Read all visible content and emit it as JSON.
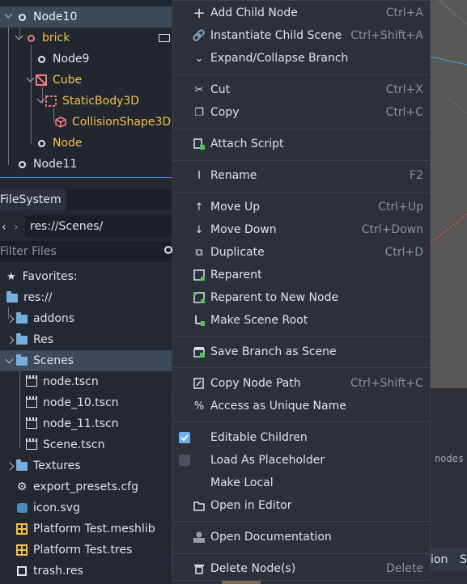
{
  "scene_tree": {
    "items": [
      {
        "label": "Node10"
      },
      {
        "label": "brick"
      },
      {
        "label": "Node9"
      },
      {
        "label": "Cube"
      },
      {
        "label": "StaticBody3D"
      },
      {
        "label": "CollisionShape3D"
      },
      {
        "label": "Node"
      },
      {
        "label": "Node11"
      }
    ],
    "colors": {
      "highlight": "#f5c34a",
      "selected_bg": "#3c4a5c",
      "accent": "#4d8fd6"
    }
  },
  "filesystem": {
    "tab_label": "FileSystem",
    "path_value": "res://Scenes/",
    "filter_placeholder": "Filter Files",
    "favorites_label": "Favorites:",
    "root_label": "res://",
    "items": [
      {
        "label": "addons",
        "icon": "folder-icon"
      },
      {
        "label": "Res",
        "icon": "folder-icon"
      },
      {
        "label": "Scenes",
        "icon": "folder-icon"
      },
      {
        "label": "node.tscn",
        "icon": "scene-file-icon"
      },
      {
        "label": "node_10.tscn",
        "icon": "scene-file-icon"
      },
      {
        "label": "node_11.tscn",
        "icon": "scene-file-icon"
      },
      {
        "label": "Scene.tscn",
        "icon": "scene-file-icon"
      },
      {
        "label": "Textures",
        "icon": "folder-icon"
      },
      {
        "label": "export_presets.cfg",
        "icon": "gear-icon"
      },
      {
        "label": "icon.svg",
        "icon": "godot-icon"
      },
      {
        "label": "Platform Test.meshlib",
        "icon": "meshlib-icon"
      },
      {
        "label": "Platform Test.tres",
        "icon": "resource-icon"
      },
      {
        "label": "trash.res",
        "icon": "resource-icon"
      }
    ]
  },
  "context_menu": {
    "items": [
      {
        "label": "Add Child Node",
        "shortcut": "Ctrl+A",
        "icon": "plus-icon"
      },
      {
        "label": "Instantiate Child Scene",
        "shortcut": "Ctrl+Shift+A",
        "icon": "link-icon"
      },
      {
        "label": "Expand/Collapse Branch",
        "shortcut": "",
        "icon": "chevron-down-icon"
      },
      {
        "label": "Cut",
        "shortcut": "Ctrl+X",
        "icon": "scissors-icon"
      },
      {
        "label": "Copy",
        "shortcut": "Ctrl+C",
        "icon": "copy-icon"
      },
      {
        "label": "Attach Script",
        "shortcut": "",
        "icon": "script-add-icon"
      },
      {
        "label": "Rename",
        "shortcut": "F2",
        "icon": "text-cursor-icon"
      },
      {
        "label": "Move Up",
        "shortcut": "Ctrl+Up",
        "icon": "arrow-up-icon"
      },
      {
        "label": "Move Down",
        "shortcut": "Ctrl+Down",
        "icon": "arrow-down-icon"
      },
      {
        "label": "Duplicate",
        "shortcut": "Ctrl+D",
        "icon": "duplicate-icon"
      },
      {
        "label": "Reparent",
        "shortcut": "",
        "icon": "reparent-icon"
      },
      {
        "label": "Reparent to New Node",
        "shortcut": "",
        "icon": "reparent-new-icon"
      },
      {
        "label": "Make Scene Root",
        "shortcut": "",
        "icon": "scene-root-icon"
      },
      {
        "label": "Save Branch as Scene",
        "shortcut": "",
        "icon": "save-scene-icon"
      },
      {
        "label": "Copy Node Path",
        "shortcut": "Ctrl+Shift+C",
        "icon": "copy-path-icon"
      },
      {
        "label": "Access as Unique Name",
        "shortcut": "",
        "icon": "percent-icon"
      },
      {
        "label": "Editable Children",
        "shortcut": "",
        "icon": "checkbox-checked-icon"
      },
      {
        "label": "Load As Placeholder",
        "shortcut": "",
        "icon": "checkbox-unchecked-icon"
      },
      {
        "label": "Make Local",
        "shortcut": "",
        "icon": ""
      },
      {
        "label": "Open in Editor",
        "shortcut": "",
        "icon": "folder-open-icon"
      },
      {
        "label": "Open Documentation",
        "shortcut": "",
        "icon": "doc-icon"
      },
      {
        "label": "Delete Node(s)",
        "shortcut": "Delete",
        "icon": "trash-icon"
      }
    ],
    "colors": {
      "check_on": "#6ab0f0"
    }
  },
  "right_panel": {
    "nodes_text": "nodes",
    "bottom_text_1": "ion",
    "bottom_text_2": "S"
  }
}
